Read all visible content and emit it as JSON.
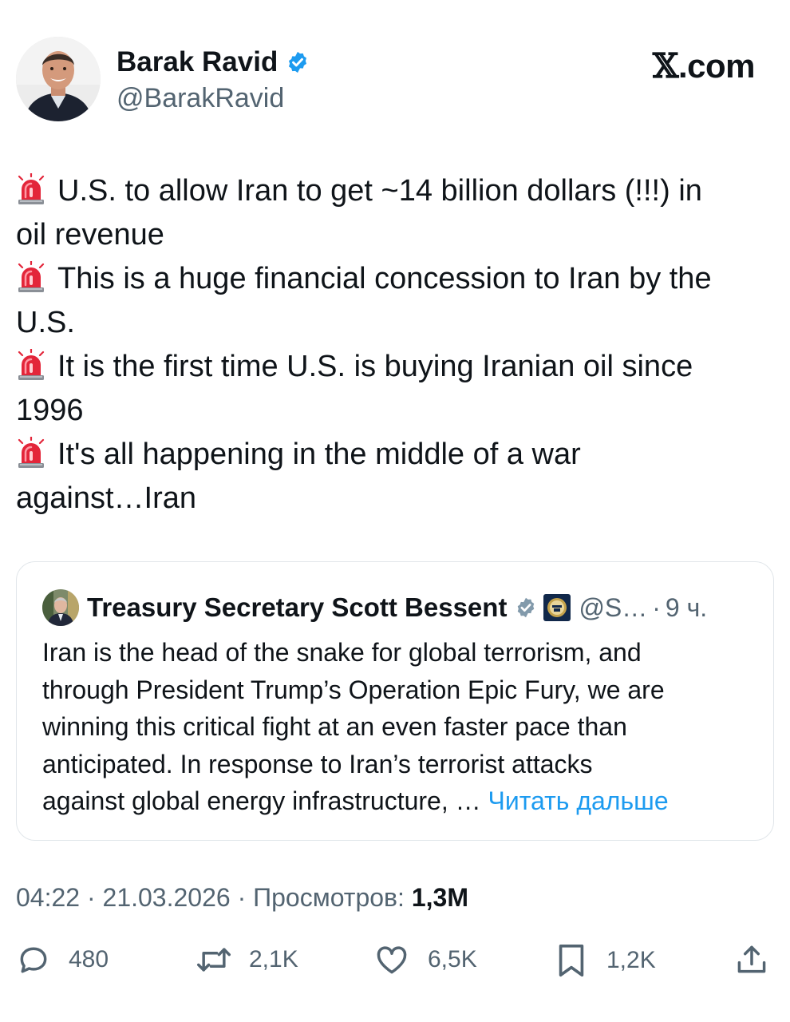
{
  "author": {
    "name": "Barak Ravid",
    "handle": "@BarakRavid",
    "verified": true
  },
  "brand": {
    "glyph": "𝕏",
    "text": ".com"
  },
  "tweet": {
    "lines": [
      {
        "icon": "siren-icon",
        "text": "U.S. to allow Iran to get ~14 billion dollars (!!!) in"
      },
      {
        "icon": "",
        "text": "oil revenue"
      },
      {
        "icon": "siren-icon",
        "text": "This is a huge financial concession to Iran by the"
      },
      {
        "icon": "",
        "text": "U.S."
      },
      {
        "icon": "siren-icon",
        "text": "It is the first time U.S. is buying Iranian oil since"
      },
      {
        "icon": "",
        "text": "1996"
      },
      {
        "icon": "siren-icon",
        "text": "It's all happening in the middle of a war"
      },
      {
        "icon": "",
        "text": "against…Iran"
      }
    ]
  },
  "quote": {
    "name": "Treasury Secretary Scott Bessent",
    "handle": "@S…",
    "separator": "·",
    "time": "9 ч.",
    "lines": [
      "Iran is the head of the snake for global terrorism, and",
      "through President Trump’s Operation Epic Fury, we are",
      "winning this critical fight at an even faster pace than",
      "anticipated.  In response to Iran’s terrorist attacks",
      "against global energy infrastructure, …"
    ],
    "read_more": "Читать дальше"
  },
  "meta": {
    "time": "04:22",
    "separator": "·",
    "date": "21.03.2026",
    "views_label": "Просмотров:",
    "views_count": "1,3M"
  },
  "actions": {
    "reply_count": "480",
    "retweet_count": "2,1K",
    "like_count": "6,5K",
    "bookmark_count": "1,2K"
  },
  "colors": {
    "text": "#0f1419",
    "secondary": "#536471",
    "link": "#1d9bf0",
    "verified": "#1d9bf0",
    "quote_verified": "#829aab",
    "border": "#e1e6ea"
  }
}
